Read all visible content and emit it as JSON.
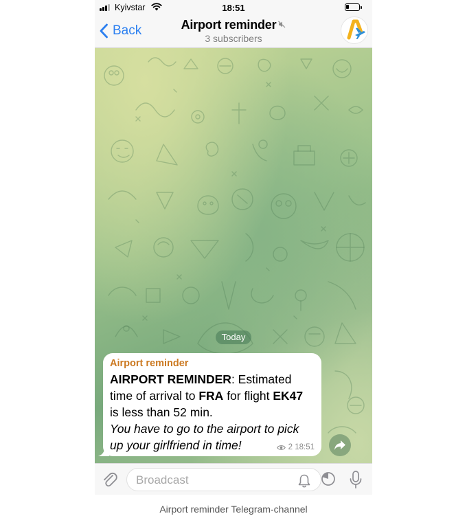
{
  "status_bar": {
    "carrier": "Kyivstar",
    "time": "18:51"
  },
  "nav": {
    "back_label": "Back",
    "title": "Airport reminder",
    "subtitle": "3 subscribers"
  },
  "chat": {
    "date_label": "Today",
    "message": {
      "sender": "Airport reminder",
      "line1_bold": "AIRPORT REMINDER",
      "line1_rest": ": Estimated time of arrival to ",
      "airport": "FRA",
      "mid": " for flight ",
      "flight": "EK47",
      "tail": " is less than 52 min.",
      "italic": " You have to go to the airport to pick up your girlfriend in time!",
      "views": "2",
      "time": "18:51"
    }
  },
  "input": {
    "placeholder": "Broadcast"
  },
  "caption": "Airport reminder Telegram-channel",
  "colors": {
    "accent": "#2b7ff0",
    "sender": "#cc7a22"
  }
}
